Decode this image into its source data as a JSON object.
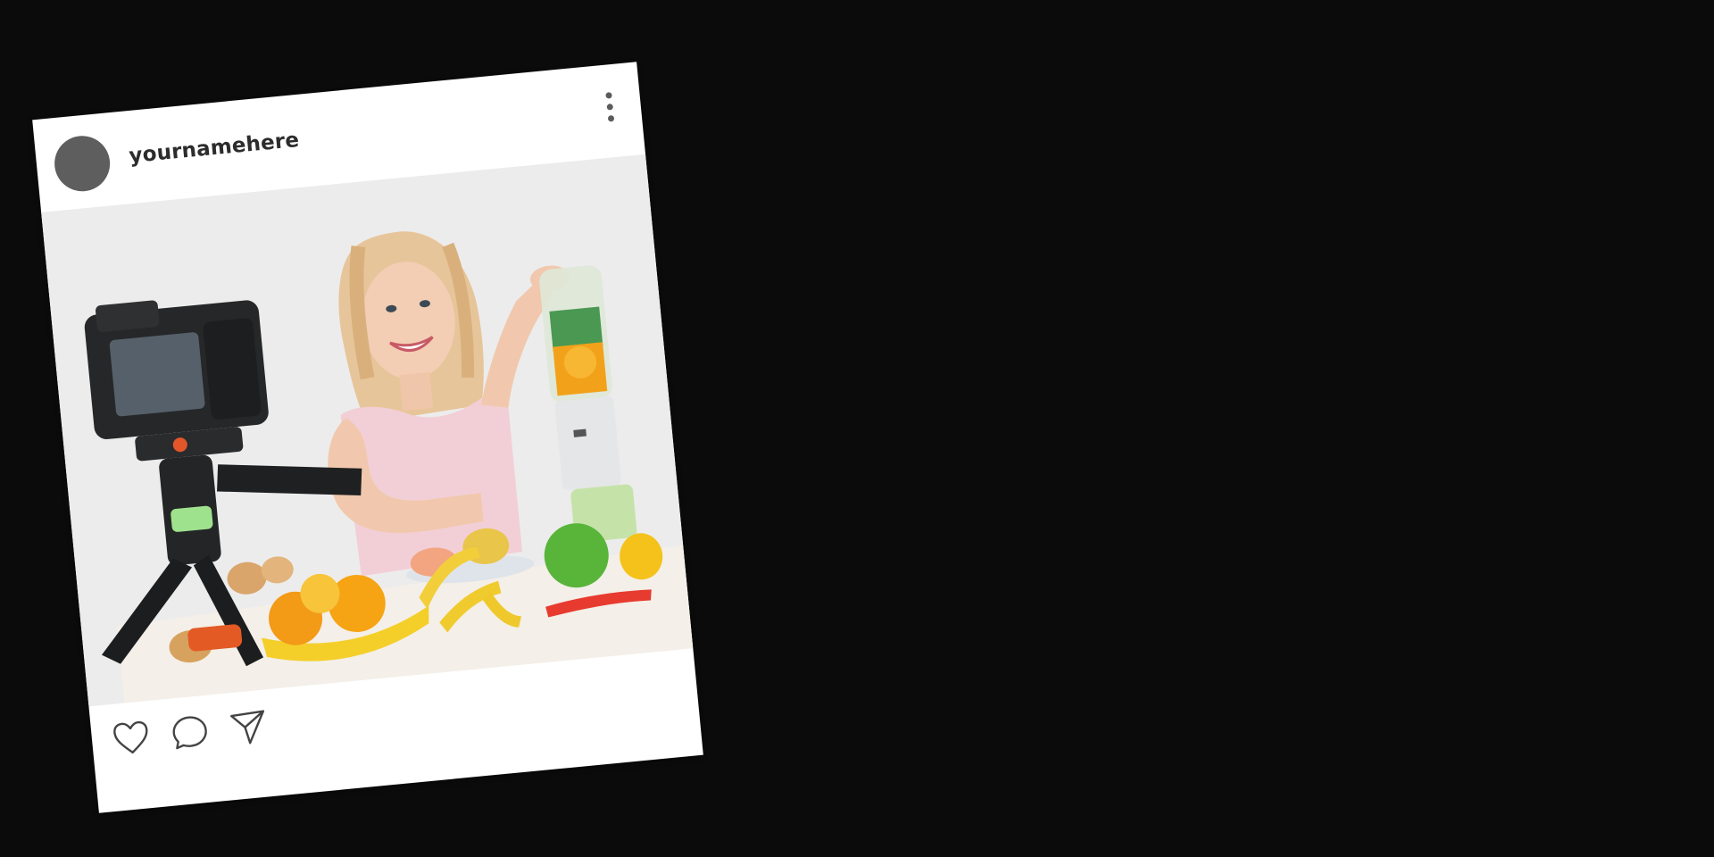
{
  "post": {
    "username": "yournamehere",
    "photo_description": "",
    "actions": {
      "like_icon": "heart-icon",
      "comment_icon": "comment-icon",
      "share_icon": "paper-plane-icon"
    },
    "more_icon": "more-vertical-icon"
  },
  "colors": {
    "background": "#0b0b0c",
    "card": "#ffffff",
    "avatar": "#5e5e5e",
    "icon_stroke": "#444444"
  }
}
